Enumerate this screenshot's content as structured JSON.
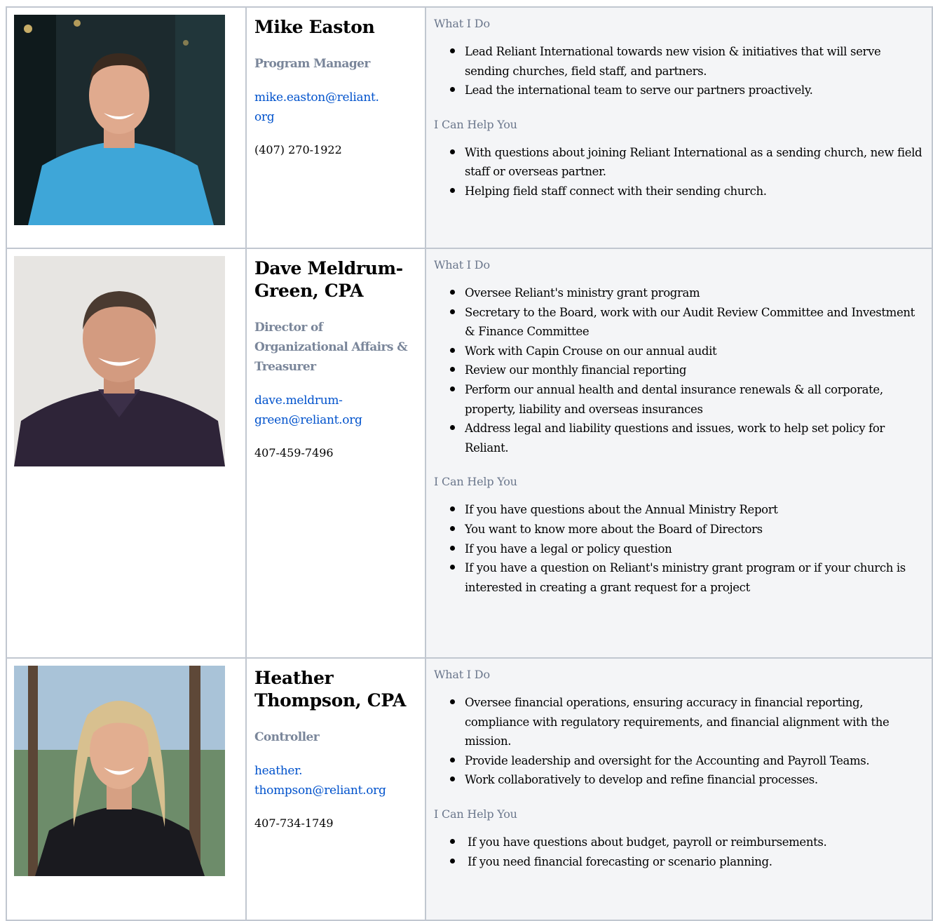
{
  "staff": [
    {
      "name": "Mike Easton",
      "title": "Program Manager",
      "email": "mike.easton@reliant.\norg",
      "phone": "(407) 270-1922",
      "photo_colors": {
        "bg": "#1c2a2e",
        "shirt": "#3ea6d8",
        "skin": "#e0aa8e",
        "hair": "#3a2a1f"
      },
      "what_heading": "What I Do",
      "what": [
        "Lead Reliant International towards new vision & initiatives that will serve sending churches, field staff, and partners.",
        "Lead the international team to serve our partners proactively."
      ],
      "help_heading": "I Can Help You",
      "help": [
        "With questions about joining Reliant International as a sending church, new field staff or overseas partner.",
        "Helping field staff connect with their sending church."
      ]
    },
    {
      "name": "Dave Meldrum-Green, CPA",
      "title": "Director of Organizational Affairs & Treasurer",
      "email": "dave.meldrum-\ngreen@reliant.org",
      "phone": "407-459-7496",
      "photo_colors": {
        "bg": "#e7e5e2",
        "shirt": "#2e2438",
        "skin": "#d39b80",
        "hair": "#4a3a30"
      },
      "what_heading": "What I Do",
      "what": [
        "Oversee Reliant's ministry grant program",
        "Secretary to the Board, work with our Audit Review Committee and Investment & Finance Committee",
        "Work with Capin Crouse on our annual audit",
        "Review our monthly financial reporting",
        "Perform our annual health and dental insurance renewals & all corporate, property, liability and overseas insurances",
        "Address legal and liability questions and issues, work to help set policy for Reliant."
      ],
      "help_heading": "I Can Help You",
      "help": [
        "If you have questions about the Annual Ministry Report",
        "You want to know more about the Board of Directors",
        "If you have a legal or policy question",
        "If you have a question on Reliant's ministry grant program or if your church is interested in creating a grant request for a project"
      ]
    },
    {
      "name": "Heather Thompson, CPA",
      "title": "Controller",
      "email": "heather.\nthompson@reliant.org",
      "phone": "407-734-1749",
      "photo_colors": {
        "bg": "#6d8c6a",
        "shirt": "#1a1a1f",
        "skin": "#e2ae90",
        "hair": "#d8c08f"
      },
      "what_heading": "What I Do",
      "what": [
        "Oversee financial operations, ensuring accuracy in financial reporting, compliance with regulatory requirements, and financial alignment with the mission.",
        "Provide leadership and oversight for the Accounting and Payroll Teams.",
        "Work collaboratively to develop and refine financial processes."
      ],
      "help_heading": "I Can Help You",
      "help": [
        "If you have questions about budget, payroll or reimbursements.",
        "If you need financial forecasting or scenario planning."
      ]
    }
  ]
}
